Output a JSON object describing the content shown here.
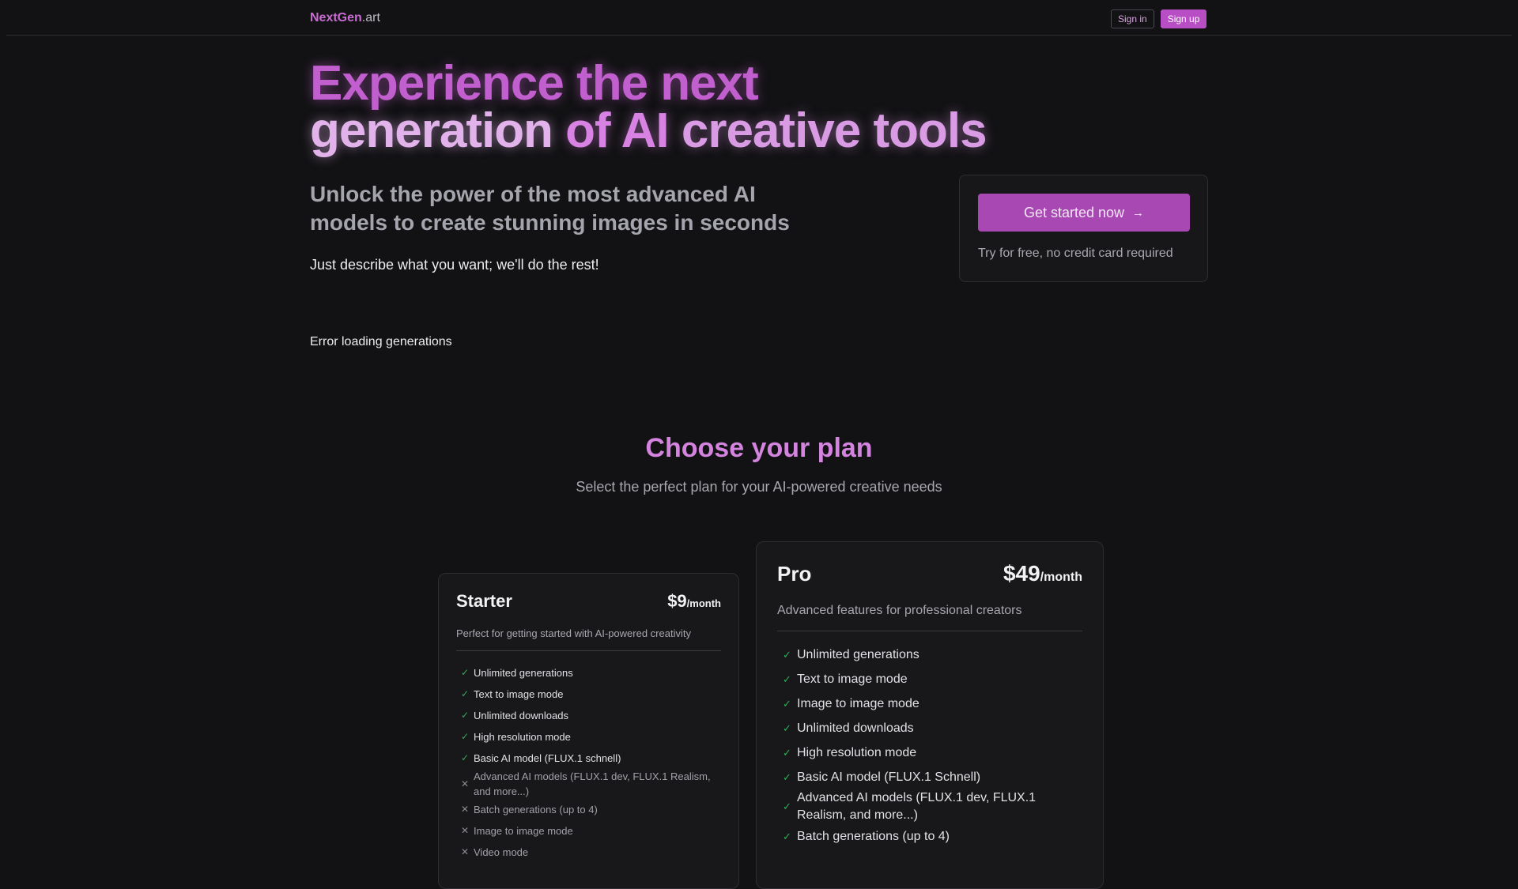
{
  "nav": {
    "brand_main": "NextGen",
    "brand_suffix": ".art",
    "sign_in": "Sign in",
    "sign_up": "Sign up"
  },
  "hero": {
    "title_part1": "Experience the next",
    "title_part2": "generation",
    "title_part3": " of AI ",
    "title_part4": "creative tools",
    "subtitle": "Unlock the power of the most advanced AI models to create stunning images in seconds",
    "tagline": "Just describe what you want; we'll do the rest!",
    "error": "Error loading generations"
  },
  "cta": {
    "button_label": "Get started now",
    "arrow": "→",
    "note": "Try for free, no credit card required"
  },
  "plans": {
    "title": "Choose your plan",
    "subtitle": "Select the perfect plan for your AI-powered creative needs",
    "starter": {
      "name": "Starter",
      "price": "$9",
      "period": "/month",
      "description": "Perfect for getting started with AI-powered creativity",
      "features": [
        {
          "text": "Unlimited generations",
          "included": true
        },
        {
          "text": "Text to image mode",
          "included": true
        },
        {
          "text": "Unlimited downloads",
          "included": true
        },
        {
          "text": "High resolution mode",
          "included": true
        },
        {
          "text": "Basic AI model (FLUX.1 schnell)",
          "included": true
        },
        {
          "text": "Advanced AI models (FLUX.1 dev, FLUX.1 Realism, and more...)",
          "included": false
        },
        {
          "text": "Batch generations (up to 4)",
          "included": false
        },
        {
          "text": "Image to image mode",
          "included": false
        },
        {
          "text": "Video mode",
          "included": false
        }
      ]
    },
    "pro": {
      "name": "Pro",
      "price": "$49",
      "period": "/month",
      "description": "Advanced features for professional creators",
      "features": [
        {
          "text": "Unlimited generations",
          "included": true
        },
        {
          "text": "Text to image mode",
          "included": true
        },
        {
          "text": "Image to image mode",
          "included": true
        },
        {
          "text": "Unlimited downloads",
          "included": true
        },
        {
          "text": "High resolution mode",
          "included": true
        },
        {
          "text": "Basic AI model (FLUX.1 Schnell)",
          "included": true
        },
        {
          "text": "Advanced AI models (FLUX.1 dev, FLUX.1 Realism, and more...)",
          "included": true
        },
        {
          "text": "Batch generations (up to 4)",
          "included": true
        }
      ]
    }
  },
  "colors": {
    "accent": "#b84ec4",
    "check": "#2fae56",
    "background": "#121214"
  }
}
